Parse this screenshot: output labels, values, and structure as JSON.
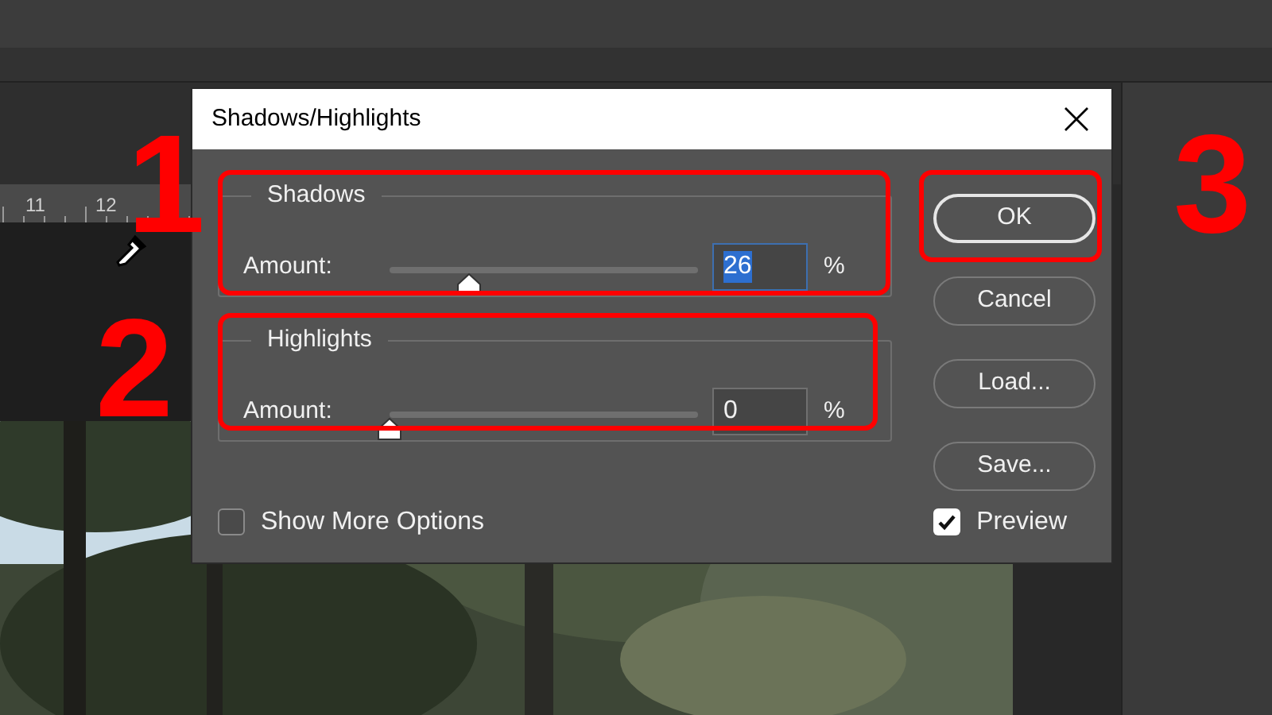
{
  "workspace": {
    "ruler_labels": [
      "11",
      "12"
    ],
    "photo": {
      "kind": "picture"
    }
  },
  "dialog": {
    "title": "Shadows/Highlights",
    "groups": [
      {
        "title": "Shadows",
        "label": "Amount:",
        "level": 0.26,
        "value": "26",
        "unit": "%",
        "value_selected": true
      },
      {
        "title": "Highlights",
        "label": "Amount:",
        "level": 0,
        "value": "0",
        "unit": "%",
        "value_selected": false
      }
    ],
    "buttons": [
      {
        "label": "OK",
        "default": true
      },
      {
        "label": "Cancel",
        "default": false
      },
      {
        "label": "Load...",
        "default": false
      },
      {
        "label": "Save...",
        "default": false
      }
    ],
    "checkboxes": [
      {
        "label": "Show More Options",
        "checked": false
      },
      {
        "label": "Preview",
        "checked": true
      }
    ]
  },
  "annotations": [
    {
      "number": "1"
    },
    {
      "number": "2"
    },
    {
      "number": "3"
    }
  ]
}
